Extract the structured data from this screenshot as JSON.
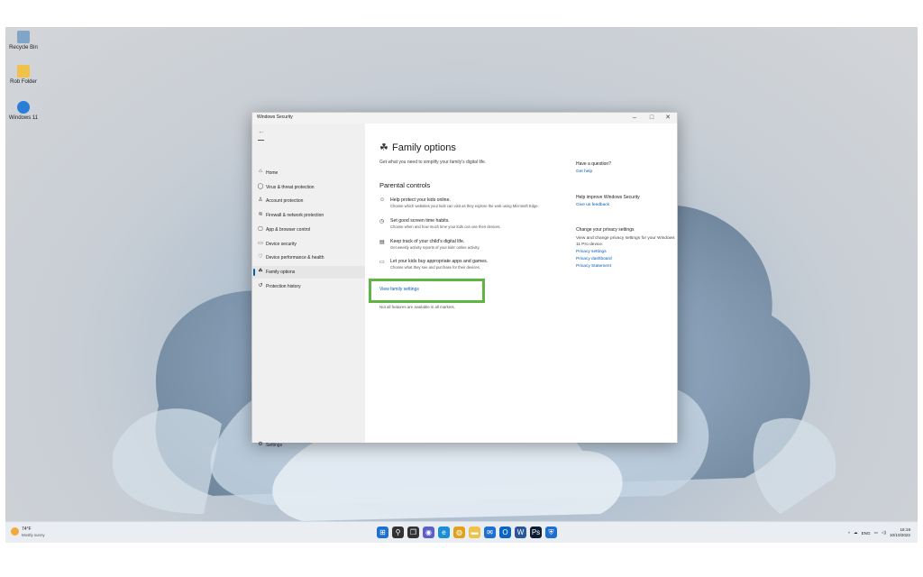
{
  "desktop": {
    "icons": [
      {
        "label": "Recycle Bin",
        "color": "#7fa6c8"
      },
      {
        "label": "Rob Folder",
        "color": "#f0c24a"
      },
      {
        "label": "Windows 11",
        "color": "#2a7ed8"
      }
    ]
  },
  "window": {
    "title": "Windows Security",
    "controls": {
      "minimize": "–",
      "maximize": "□",
      "close": "✕"
    },
    "sidebar": {
      "back": "←",
      "items": [
        {
          "label": "Home",
          "icon": "home-icon",
          "glyph": "⌂"
        },
        {
          "label": "Virus & threat protection",
          "icon": "shield-icon",
          "glyph": "◯"
        },
        {
          "label": "Account protection",
          "icon": "person-icon",
          "glyph": "♙"
        },
        {
          "label": "Firewall & network protection",
          "icon": "wifi-icon",
          "glyph": "≋"
        },
        {
          "label": "App & browser control",
          "icon": "app-window-icon",
          "glyph": "▢"
        },
        {
          "label": "Device security",
          "icon": "laptop-icon",
          "glyph": "▭"
        },
        {
          "label": "Device performance & health",
          "icon": "heart-icon",
          "glyph": "♡"
        },
        {
          "label": "Family options",
          "icon": "family-icon",
          "glyph": "☘"
        },
        {
          "label": "Protection history",
          "icon": "history-icon",
          "glyph": "↺"
        }
      ],
      "settings": {
        "label": "Settings",
        "glyph": "⚙"
      }
    },
    "main": {
      "title": "Family options",
      "title_glyph": "☘",
      "subtitle": "Get what you need to simplify your family's digital life.",
      "section_title": "Parental controls",
      "features": [
        {
          "title": "Help protect your kids online.",
          "desc": "Choose which websites your kids can visit as they explore the web using Microsoft Edge.",
          "glyph": "☺",
          "icon": "smile-icon"
        },
        {
          "title": "Set good screen time habits.",
          "desc": "Choose when and how much time your kids can use their devices.",
          "glyph": "◷",
          "icon": "clock-icon"
        },
        {
          "title": "Keep track of your child's digital life.",
          "desc": "Get weekly activity reports of your kids' online activity.",
          "glyph": "▤",
          "icon": "report-icon"
        },
        {
          "title": "Let your kids buy appropriate apps and games.",
          "desc": "Choose what they see and purchase for their devices.",
          "glyph": "▭",
          "icon": "card-icon"
        }
      ],
      "view_link": "View family settings",
      "note": "Not all features are available in all markets."
    },
    "right_column": {
      "question_heading": "Have a question?",
      "get_help": "Get help",
      "improve_heading": "Help improve Windows Security",
      "feedback": "Give us feedback",
      "privacy_heading": "Change your privacy settings",
      "privacy_text": "View and change privacy settings for your Windows 11 Pro device.",
      "privacy_settings": "Privacy settings",
      "privacy_dashboard": "Privacy dashboard",
      "privacy_statement": "Privacy Statement"
    }
  },
  "taskbar": {
    "weather_temp": "74°F",
    "weather_desc": "Mostly sunny",
    "apps": [
      {
        "name": "start-icon",
        "glyph": "⊞",
        "color": "#1f6fd1"
      },
      {
        "name": "search-icon",
        "glyph": "⚲",
        "color": "#333333"
      },
      {
        "name": "task-view-icon",
        "glyph": "❐",
        "color": "#333333"
      },
      {
        "name": "chat-icon",
        "glyph": "◉",
        "color": "#5b5fc7"
      },
      {
        "name": "edge-icon",
        "glyph": "e",
        "color": "#1b8fd6"
      },
      {
        "name": "chrome-icon",
        "glyph": "◍",
        "color": "#e0a21b"
      },
      {
        "name": "explorer-icon",
        "glyph": "▬",
        "color": "#f0c24a"
      },
      {
        "name": "mail-icon",
        "glyph": "✉",
        "color": "#1f6fd1"
      },
      {
        "name": "outlook-icon",
        "glyph": "O",
        "color": "#0a64c4"
      },
      {
        "name": "word-icon",
        "glyph": "W",
        "color": "#2b579a"
      },
      {
        "name": "photoshop-icon",
        "glyph": "Ps",
        "color": "#0d1a33"
      },
      {
        "name": "security-icon",
        "glyph": "⛨",
        "color": "#1f6fd1"
      }
    ],
    "tray": {
      "chevron": "^",
      "language": "ENG",
      "time": "16:19",
      "date": "10/10/2022"
    }
  }
}
